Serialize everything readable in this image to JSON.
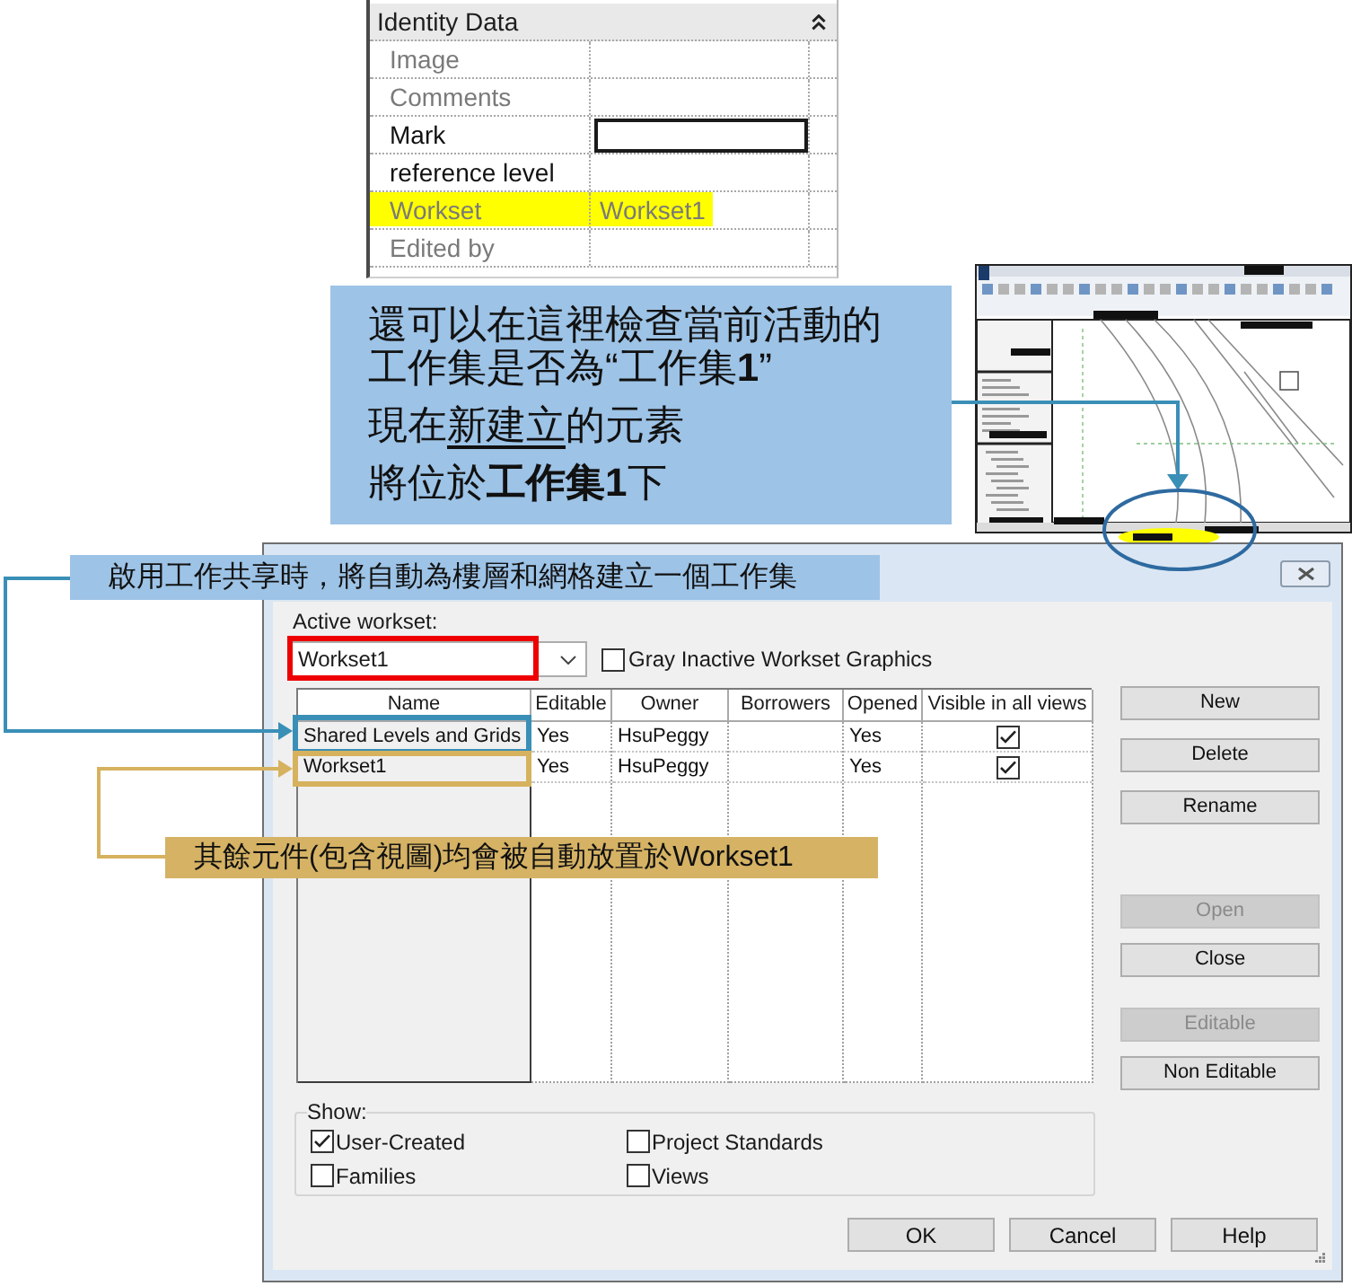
{
  "properties_panel": {
    "group": {
      "title": "Identity Data",
      "expanded": true
    },
    "rows": [
      {
        "label": "Image",
        "kind": "plain",
        "disabled": true,
        "highlighted": false
      },
      {
        "label": "Comments",
        "kind": "plain",
        "disabled": true,
        "highlighted": false
      },
      {
        "label": "Mark",
        "kind": "field",
        "disabled": false,
        "highlighted": false
      },
      {
        "label": "reference level",
        "kind": "plain",
        "disabled": false,
        "highlighted": false
      },
      {
        "label": "Workset",
        "value": "Workset1",
        "kind": "plain",
        "disabled": true,
        "highlighted": true
      },
      {
        "label": "Edited by",
        "kind": "plain",
        "disabled": true,
        "highlighted": false
      }
    ]
  },
  "callout": {
    "paragraphs": [
      {
        "segments": [
          {
            "text": "還可以在這裡檢查當前活動的工作集是否為“工作集**1**”",
            "underlined": false
          }
        ]
      },
      {
        "segments": [
          {
            "text": "現在",
            "underlined": false
          },
          {
            "text": "新建立",
            "underlined": true
          },
          {
            "text": "的元素",
            "underlined": false
          }
        ]
      },
      {
        "segments": [
          {
            "text": "將位於**工作集1**下",
            "underlined": false
          }
        ]
      }
    ]
  },
  "workset_note": "啟用工作共享時，將自動為樓層和網格建立一個工作集",
  "dialog": {
    "active_workset": {
      "label": "Active workset:",
      "value": "Workset1"
    },
    "gray_inactive_graphics": {
      "label": "Gray Inactive Workset Graphics",
      "checked": false
    },
    "table": {
      "columns": [
        "Name",
        "Editable",
        "Owner",
        "Borrowers",
        "Opened",
        "Visible in all views"
      ],
      "rows": [
        {
          "name": "Shared Levels and Grids",
          "editable": "Yes",
          "owner": "HsuPeggy",
          "opened": "Yes",
          "visible_in_all_views": true
        },
        {
          "name": "Workset1",
          "editable": "Yes",
          "owner": "HsuPeggy",
          "opened": "Yes",
          "visible_in_all_views": true
        }
      ]
    },
    "side_button_groups": [
      {
        "buttons": [
          {
            "label": "New",
            "disabled": false
          },
          {
            "label": "Delete",
            "disabled": false
          },
          {
            "label": "Rename",
            "disabled": false
          }
        ]
      },
      {
        "buttons": [
          {
            "label": "Open",
            "disabled": true
          },
          {
            "label": "Close",
            "disabled": false
          }
        ]
      },
      {
        "buttons": [
          {
            "label": "Editable",
            "disabled": true
          },
          {
            "label": "Non Editable",
            "disabled": false
          }
        ]
      }
    ],
    "show": {
      "label": "Show:",
      "options": [
        {
          "label": "User-Created",
          "checked": true
        },
        {
          "label": "Project Standards",
          "checked": false
        },
        {
          "label": "Families",
          "checked": false
        },
        {
          "label": "Views",
          "checked": false
        }
      ]
    },
    "footer_buttons": [
      "OK",
      "Cancel",
      "Help"
    ]
  },
  "default_note": "其餘元件(包含視圖)均會被自動放置於Workset1"
}
